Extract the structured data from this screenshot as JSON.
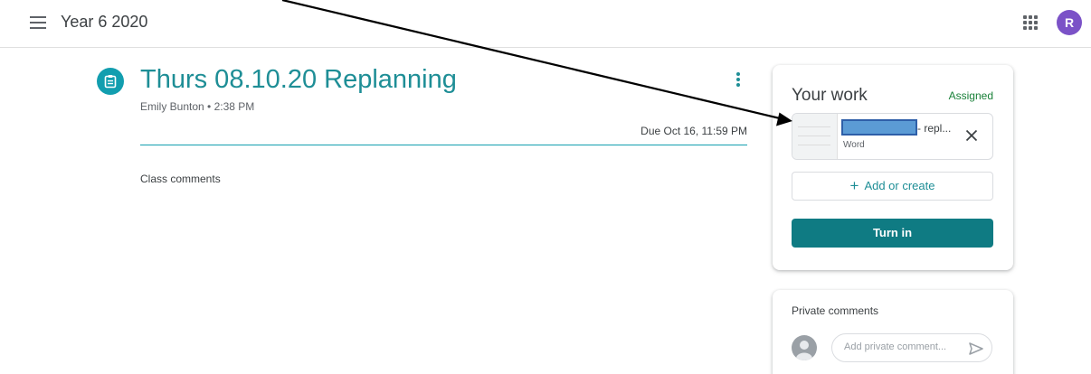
{
  "header": {
    "class_title": "Year 6 2020",
    "avatar_letter": "R",
    "avatar_color": "#7b52c7"
  },
  "assignment": {
    "title": "Thurs 08.10.20 Replanning",
    "meta": "Emily Bunton • 2:38 PM",
    "due": "Due Oct 16, 11:59 PM",
    "class_comments_label": "Class comments",
    "icon": "assignment-icon",
    "accent_color": "#1e8e96"
  },
  "your_work": {
    "title": "Your work",
    "status": "Assigned",
    "status_color": "#188038",
    "attachment": {
      "name": "- repl...",
      "type": "Word"
    },
    "add_or_create_label": "Add or create",
    "turn_in_label": "Turn in",
    "turn_in_color": "#0f7b83"
  },
  "private_comments": {
    "title": "Private comments",
    "placeholder": "Add private comment..."
  }
}
